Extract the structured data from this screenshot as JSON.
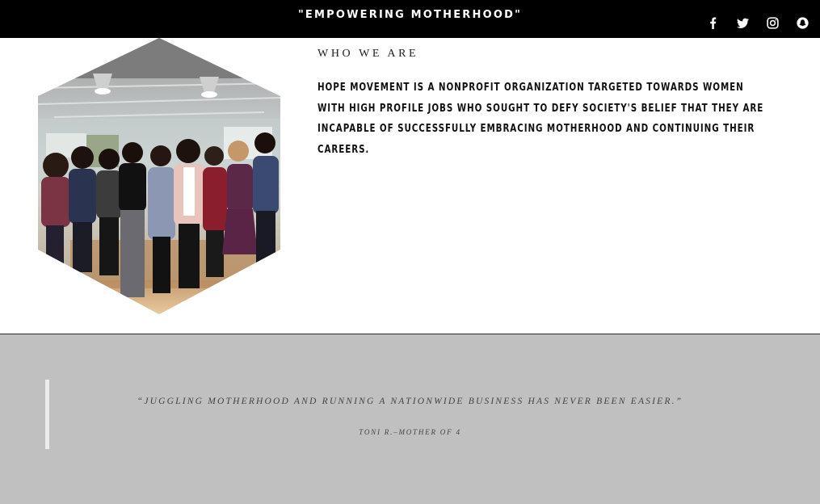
{
  "header": {
    "tagline": "\"EMPOWERING MOTHERHOOD\"",
    "social": [
      {
        "icon": "facebook-icon"
      },
      {
        "icon": "twitter-icon"
      },
      {
        "icon": "instagram-icon"
      },
      {
        "icon": "snapchat-icon"
      }
    ]
  },
  "about": {
    "heading": "WHO WE ARE",
    "body": "HOPE MOVEMENT IS A NONPROFIT ORGANIZATION TARGETED TOWARDS WOMEN WITH HIGH PROFILE JOBS WHO SOUGHT TO DEFY SOCIETY'S BELIEF THAT THEY ARE INCAPABLE OF SUCCESSFULLY EMBRACING MOTHERHOOD AND CONTINUING THEIR CAREERS.",
    "image_icon": "team-photo"
  },
  "testimonial": {
    "quote": "“JUGGLING MOTHERHOOD AND RUNNING A NATIONWIDE BUSINESS HAS NEVER BEEN EASIER.”",
    "author": "TONI R.–MOTHER OF 4"
  },
  "colors": {
    "header_bg": "#000000",
    "quote_band_bg": "#c0c0c0",
    "quote_bar": "#ececec"
  }
}
